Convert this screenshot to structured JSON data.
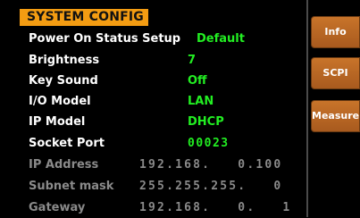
{
  "title": "SYSTEM  CONFIG",
  "rows": [
    {
      "label": "Power On Status Setup",
      "value": "Default"
    },
    {
      "label": "Brightness",
      "value": "7"
    },
    {
      "label": "Key Sound",
      "value": "Off"
    },
    {
      "label": "I/O Model",
      "value": "LAN"
    },
    {
      "label": "IP Model",
      "value": "DHCP"
    },
    {
      "label": "Socket Port",
      "value": "00023"
    },
    {
      "label": "IP Address",
      "value": "192.168.   0.100"
    },
    {
      "label": "Subnet mask",
      "value": "255.255.255.   0"
    },
    {
      "label": "Gateway",
      "value": "192.168.   0.   1"
    }
  ],
  "softkeys": {
    "info": "Info",
    "scpi": "SCPI",
    "measure": "Measure"
  }
}
